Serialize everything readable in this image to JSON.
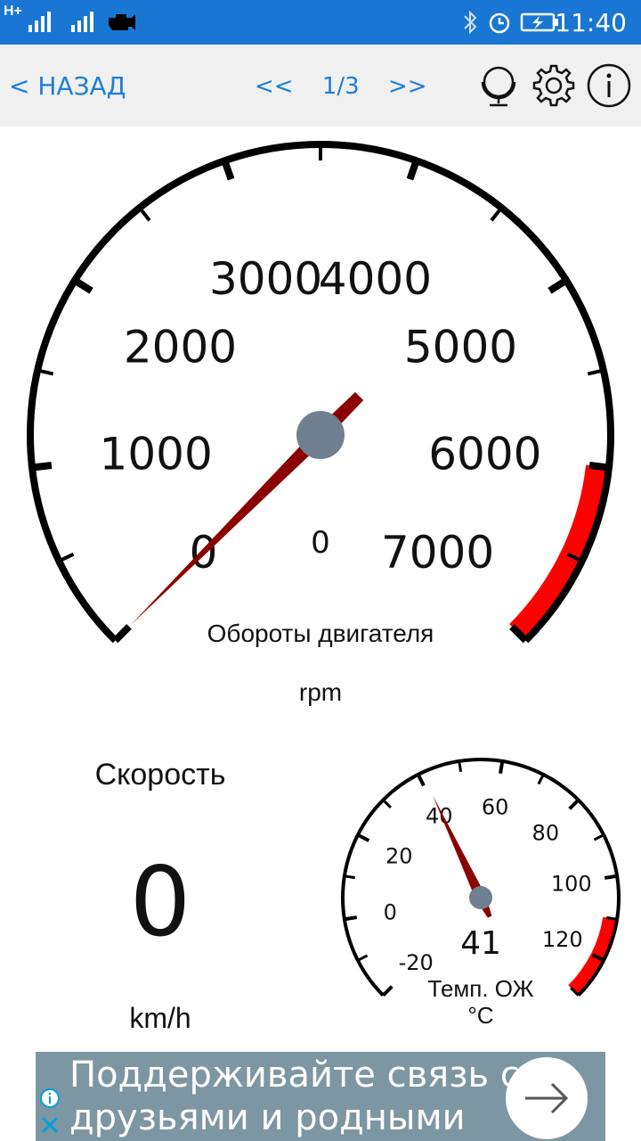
{
  "status_bar": {
    "network": "H+",
    "time": "11:40"
  },
  "toolbar": {
    "back_label": "< НАЗАД",
    "prev": "<<",
    "page": "1/3",
    "next": ">>"
  },
  "icons": [
    "globe-icon",
    "gear-icon",
    "info-icon"
  ],
  "colors": {
    "accent": "#1e7fd6",
    "redline": "#ff0000",
    "needle": "#8b0000",
    "hub": "#708090"
  },
  "rpm_gauge": {
    "title": "Обороты двигателя",
    "unit": "rpm",
    "digital_value": "0",
    "value": 0,
    "min": 0,
    "max": 7000,
    "tick_labels": [
      "0",
      "1000",
      "2000",
      "3000",
      "4000",
      "5000",
      "6000",
      "7000"
    ],
    "redline_from": 6000
  },
  "speed": {
    "label": "Скорость",
    "value": "0",
    "unit": "km/h"
  },
  "temp_gauge": {
    "title": "Темп. ОЖ",
    "unit": "°C",
    "digital_value": "41",
    "value": 41,
    "min": -20,
    "max": 130,
    "tick_labels": [
      "-20",
      "0",
      "20",
      "40",
      "60",
      "80",
      "100",
      "120"
    ],
    "redline_from": 110
  },
  "ad": {
    "text": "Поддерживайте связь с\nдрузьями и родными"
  }
}
